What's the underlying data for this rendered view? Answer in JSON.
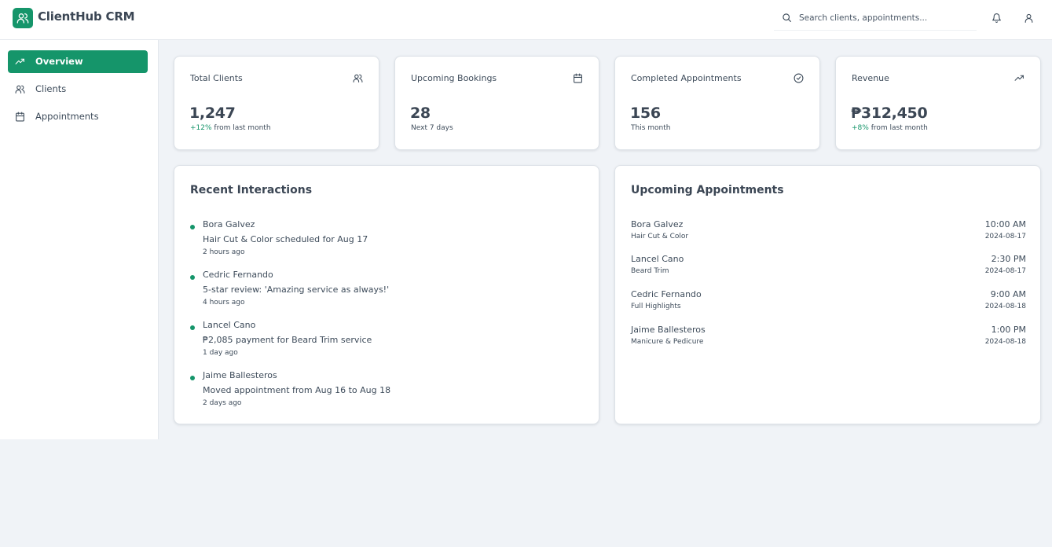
{
  "app": {
    "title": "ClientHub CRM",
    "accent_color": "#15956a"
  },
  "header": {
    "search_placeholder": "Search clients, appointments...",
    "icons": [
      "search-icon",
      "bell-icon",
      "user-icon"
    ]
  },
  "sidebar": {
    "items": [
      {
        "label": "Overview",
        "icon": "trending-up-icon",
        "active": true
      },
      {
        "label": "Clients",
        "icon": "users-icon",
        "active": false
      },
      {
        "label": "Appointments",
        "icon": "calendar-icon",
        "active": false
      }
    ]
  },
  "stats": [
    {
      "title": "Total Clients",
      "value": "1,247",
      "change": "+12%",
      "sub": " from last month",
      "icon": "users-icon"
    },
    {
      "title": "Upcoming Bookings",
      "value": "28",
      "change": "",
      "sub": "Next 7 days",
      "icon": "calendar-icon"
    },
    {
      "title": "Completed Appointments",
      "value": "156",
      "change": "",
      "sub": "This month",
      "icon": "check-circle-icon"
    },
    {
      "title": "Revenue",
      "value": "₱312,450",
      "change": "+8%",
      "sub": " from last month",
      "icon": "trending-up-icon"
    }
  ],
  "recent_interactions": {
    "title": "Recent Interactions",
    "items": [
      {
        "name": "Bora Galvez",
        "description": "Hair Cut & Color scheduled for Aug 17",
        "time": "2 hours ago"
      },
      {
        "name": "Cedric Fernando",
        "description": "5-star review: 'Amazing service as always!'",
        "time": "4 hours ago"
      },
      {
        "name": "Lancel Cano",
        "description": "₱2,085 payment for Beard Trim service",
        "time": "1 day ago"
      },
      {
        "name": "Jaime Ballesteros",
        "description": "Moved appointment from Aug 16 to Aug 18",
        "time": "2 days ago"
      }
    ]
  },
  "upcoming_appointments": {
    "title": "Upcoming Appointments",
    "items": [
      {
        "name": "Bora Galvez",
        "service": "Hair Cut & Color",
        "time": "10:00 AM",
        "date": "2024-08-17"
      },
      {
        "name": "Lancel Cano",
        "service": "Beard Trim",
        "time": "2:30 PM",
        "date": "2024-08-17"
      },
      {
        "name": "Cedric Fernando",
        "service": "Full Highlights",
        "time": "9:00 AM",
        "date": "2024-08-18"
      },
      {
        "name": "Jaime Ballesteros",
        "service": "Manicure & Pedicure",
        "time": "1:00 PM",
        "date": "2024-08-18"
      }
    ]
  }
}
